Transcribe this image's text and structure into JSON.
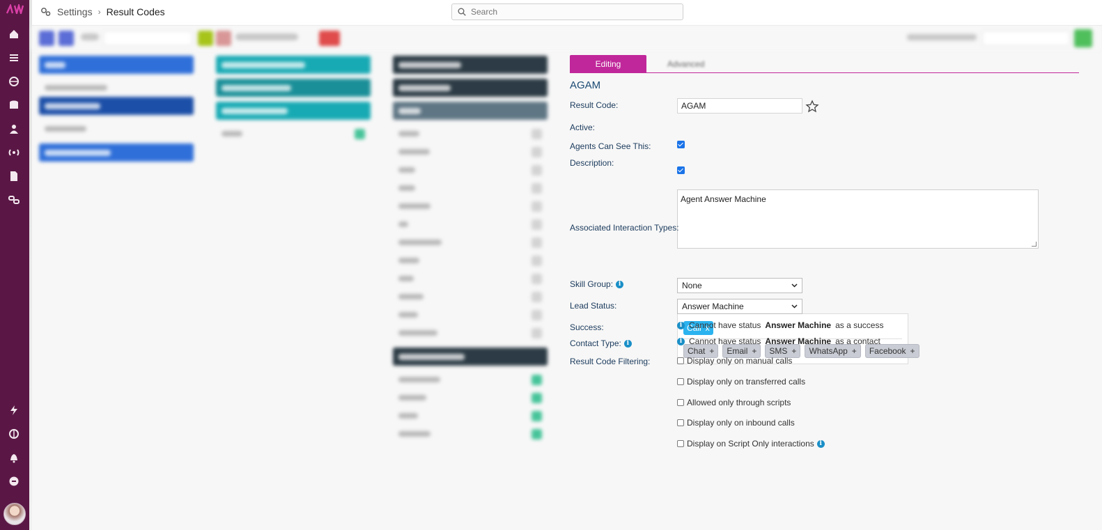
{
  "header": {
    "breadcrumb_root": "Settings",
    "breadcrumb_sep": "›",
    "breadcrumb_current": "Result Codes",
    "search_placeholder": "Search"
  },
  "colors": {
    "rail": "#5a1745",
    "accent": "#c0279a",
    "chip_active": "#2bb3ef",
    "info": "#1a8fc7"
  },
  "rail_icons": [
    "home-icon",
    "list-icon",
    "globe-icon",
    "database-icon",
    "users-icon",
    "broadcast-icon",
    "document-icon",
    "link-icon",
    "lightning-icon",
    "globe-icon-2",
    "bell-icon",
    "help-icon"
  ],
  "tabs": {
    "editing": "Editing",
    "advanced": "Advanced"
  },
  "record": {
    "title": "AGAM",
    "result_code_label": "Result Code:",
    "result_code_value": "AGAM",
    "active_label": "Active:",
    "active": true,
    "agents_label": "Agents Can See This:",
    "agents_can_see": true,
    "description_label": "Description:",
    "description_value": "Agent Answer Machine",
    "interaction_types_label": "Associated Interaction Types:",
    "interaction_selected": [
      {
        "label": "Call",
        "action": "x"
      }
    ],
    "interaction_available": [
      {
        "label": "Chat",
        "action": "+"
      },
      {
        "label": "Email",
        "action": "+"
      },
      {
        "label": "SMS",
        "action": "+"
      },
      {
        "label": "WhatsApp",
        "action": "+"
      },
      {
        "label": "Facebook",
        "action": "+"
      }
    ],
    "skill_group_label": "Skill Group:",
    "skill_group_value": "None",
    "lead_status_label": "Lead Status:",
    "lead_status_value": "Answer Machine",
    "success_label": "Success:",
    "success_note_pre": "Cannot have status",
    "success_note_bold": "Answer Machine",
    "success_note_post": "as a success",
    "contact_type_label": "Contact Type:",
    "contact_note_pre": "Cannot have status",
    "contact_note_bold": "Answer Machine",
    "contact_note_post": "as a contact",
    "filtering_label": "Result Code Filtering:",
    "filter_options": [
      "Display only on manual calls",
      "Display only on transferred calls",
      "Allowed only through scripts",
      "Display only on inbound calls",
      "Display on Script Only interactions"
    ]
  }
}
